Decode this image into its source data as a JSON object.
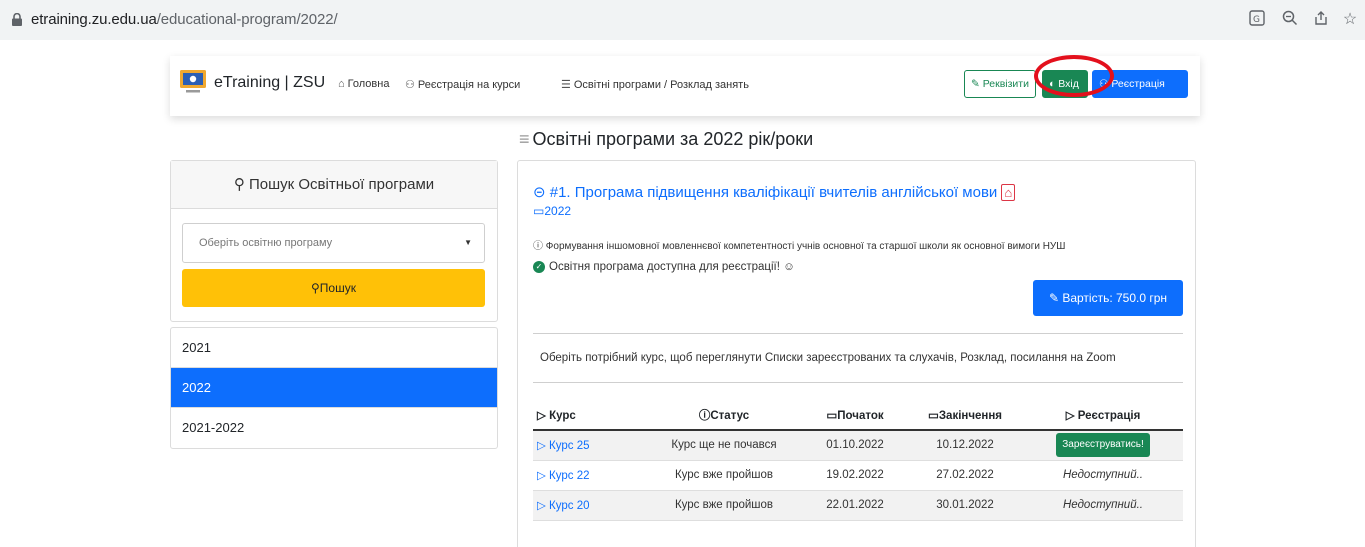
{
  "browser": {
    "domain": "etraining.zu.edu.ua",
    "path": "/educational-program/2022/"
  },
  "nav": {
    "brand": "eTraining | ZSU",
    "home": "Головна",
    "course_reg": "Реєстрація на курси",
    "programs": "Освітні програми / Розклад занять",
    "rekvizyty": "Реквізити",
    "vhid": "Вхід",
    "registration": "Реєстрація"
  },
  "page_title": "Освітні програми за 2022 рік/роки",
  "search": {
    "heading": "Пошук Освітньої програми",
    "select_placeholder": "Оберіть освітню програму",
    "button": "Пошук"
  },
  "years": [
    {
      "label": "2021",
      "active": false
    },
    {
      "label": "2022",
      "active": true
    },
    {
      "label": "2021-2022",
      "active": false
    }
  ],
  "program": {
    "title": "#1. Програма підвищення кваліфікації вчителів англійської мови",
    "year": "2022",
    "description": "Формування іншомовної мовленнєвої компетентності учнів основної та старшої школи як основної вимоги НУШ",
    "availability": "Освітня програма доступна для реєстрації!",
    "price": "Вартість: 750.0 грн",
    "instruction": "Оберіть потрібний курс, щоб переглянути Списки зареєстрованих та слухачів, Розклад, посилання на Zoom"
  },
  "table": {
    "headers": [
      "Курс",
      "Статус",
      "Початок",
      "Закінчення",
      "Реєстрація"
    ],
    "rows": [
      {
        "course": "Курс 25",
        "status": "Курс ще не почався",
        "start": "01.10.2022",
        "end": "10.12.2022",
        "registration": "Зареєструватись!"
      },
      {
        "course": "Курс 22",
        "status": "Курс вже пройшов",
        "start": "19.02.2022",
        "end": "27.02.2022",
        "registration": "Недоступний.."
      },
      {
        "course": "Курс 20",
        "status": "Курс вже пройшов",
        "start": "22.01.2022",
        "end": "30.01.2022",
        "registration": "Недоступний.."
      }
    ]
  },
  "colors": {
    "primary": "#0d6efd",
    "success": "#198754",
    "warning": "#ffc107",
    "highlight": "#e3101c"
  }
}
